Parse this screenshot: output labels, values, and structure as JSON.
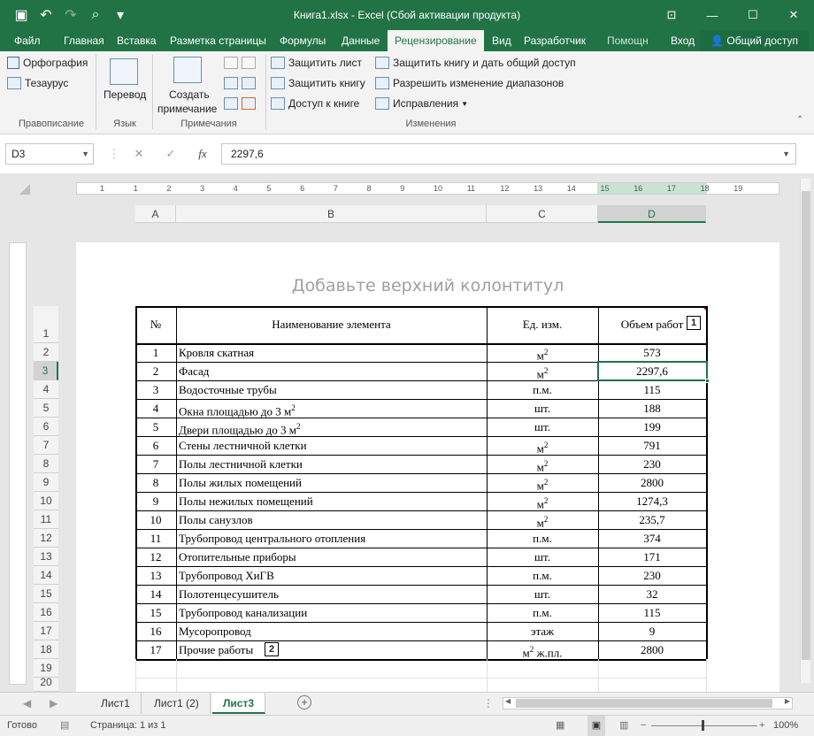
{
  "titlebar": {
    "title": "Книга1.xlsx - Excel (Сбой активации продукта)",
    "qat": [
      {
        "icon": "save-icon",
        "glyph": "▣"
      },
      {
        "icon": "undo-icon",
        "glyph": "↶"
      },
      {
        "icon": "redo-icon",
        "glyph": "↷"
      },
      {
        "icon": "print-preview-icon",
        "glyph": "⌕"
      },
      {
        "icon": "customize-qat-icon",
        "glyph": "▾"
      }
    ],
    "window_buttons": [
      {
        "icon": "ribbon-display-icon",
        "glyph": "⊡"
      },
      {
        "icon": "minimize-icon",
        "glyph": "—"
      },
      {
        "icon": "maximize-icon",
        "glyph": "☐"
      },
      {
        "icon": "close-icon",
        "glyph": "✕"
      }
    ]
  },
  "tabs": [
    "Файл",
    "Главная",
    "Вставка",
    "Разметка страницы",
    "Формулы",
    "Данные",
    "Рецензирование",
    "Вид",
    "Разработчик",
    "Помощн",
    "Вход"
  ],
  "active_tab": "Рецензирование",
  "share": "Общий доступ",
  "ribbon": {
    "spelling": "Орфография",
    "thesaurus": "Тезаурус",
    "proofing_label": "Правописание",
    "translate": "Перевод",
    "language_label": "Язык",
    "new_comment_1": "Создать",
    "new_comment_2": "примечание",
    "comments_label": "Примечания",
    "protect_sheet": "Защитить лист",
    "protect_book": "Защитить книгу",
    "share_book": "Доступ к книге",
    "protect_share": "Защитить книгу и дать общий доступ",
    "allow_ranges": "Разрешить изменение диапазонов",
    "track_changes": "Исправления",
    "changes_label": "Изменения"
  },
  "formula_bar": {
    "name_box": "D3",
    "cancel": "✕",
    "enter": "✓",
    "fx": "fx",
    "value": "2297,6"
  },
  "ruler_numbers": [
    "1",
    "1",
    "2",
    "3",
    "4",
    "5",
    "6",
    "7",
    "8",
    "9",
    "10",
    "11",
    "12",
    "13",
    "14",
    "15",
    "16",
    "17",
    "18",
    "19"
  ],
  "columns": [
    "A",
    "B",
    "C",
    "D"
  ],
  "header_placeholder": "Добавьте верхний колонтитул",
  "table_header": {
    "num": "№",
    "name": "Наименование элемента",
    "unit": "Ед. изм.",
    "volume": "Объем работ"
  },
  "rows": [
    {
      "n": "1",
      "name": "Кровля скатная",
      "unit": "м",
      "sup": "2",
      "vol": "573"
    },
    {
      "n": "2",
      "name": "Фасад",
      "unit": "м",
      "sup": "2",
      "vol": "2297,6"
    },
    {
      "n": "3",
      "name": "Водосточные трубы",
      "unit": "п.м.",
      "sup": "",
      "vol": "115"
    },
    {
      "n": "4",
      "name": "Окна площадью до 3 м",
      "name_sup": "2",
      "unit": "шт.",
      "sup": "",
      "vol": "188"
    },
    {
      "n": "5",
      "name": "Двери площадью до 3 м",
      "name_sup": "2",
      "unit": "шт.",
      "sup": "",
      "vol": "199"
    },
    {
      "n": "6",
      "name": "Стены лестничной клетки",
      "unit": "м",
      "sup": "2",
      "vol": "791"
    },
    {
      "n": "7",
      "name": "Полы лестничной клетки",
      "unit": "м",
      "sup": "2",
      "vol": "230"
    },
    {
      "n": "8",
      "name": "Полы жилых помещений",
      "unit": "м",
      "sup": "2",
      "vol": "2800"
    },
    {
      "n": "9",
      "name": "Полы нежилых помещений",
      "unit": "м",
      "sup": "2",
      "vol": "1274,3"
    },
    {
      "n": "10",
      "name": "Полы санузлов",
      "unit": "м",
      "sup": "2",
      "vol": "235,7"
    },
    {
      "n": "11",
      "name": "Трубопровод центрального отопления",
      "unit": "п.м.",
      "sup": "",
      "vol": "374"
    },
    {
      "n": "12",
      "name": "Отопительные приборы",
      "unit": "шт.",
      "sup": "",
      "vol": "171"
    },
    {
      "n": "13",
      "name": "Трубопровод ХиГВ",
      "unit": "п.м.",
      "sup": "",
      "vol": "230"
    },
    {
      "n": "14",
      "name": "Полотенцесушитель",
      "unit": "шт.",
      "sup": "",
      "vol": "32"
    },
    {
      "n": "15",
      "name": "Трубопровод канализации",
      "unit": "п.м.",
      "sup": "",
      "vol": "115"
    },
    {
      "n": "16",
      "name": "Мусоропровод",
      "unit": "этаж",
      "sup": "",
      "vol": "9"
    },
    {
      "n": "17",
      "name": "Прочие работы",
      "unit": "м",
      "sup": "2",
      "unit_tail": " ж.пл.",
      "vol": "2800"
    }
  ],
  "row_numbers": [
    "1",
    "2",
    "3",
    "4",
    "5",
    "6",
    "7",
    "8",
    "9",
    "10",
    "11",
    "12",
    "13",
    "14",
    "15",
    "16",
    "17",
    "18",
    "19",
    "20"
  ],
  "callouts": [
    "1",
    "2"
  ],
  "sheet_tabs": [
    "Лист1",
    "Лист1 (2)",
    "Лист3"
  ],
  "active_sheet": "Лист3",
  "status": {
    "ready": "Готово",
    "page": "Страница: 1 из 1",
    "zoom": "100%"
  },
  "colors": {
    "accent": "#217346",
    "selection": "#217346"
  }
}
